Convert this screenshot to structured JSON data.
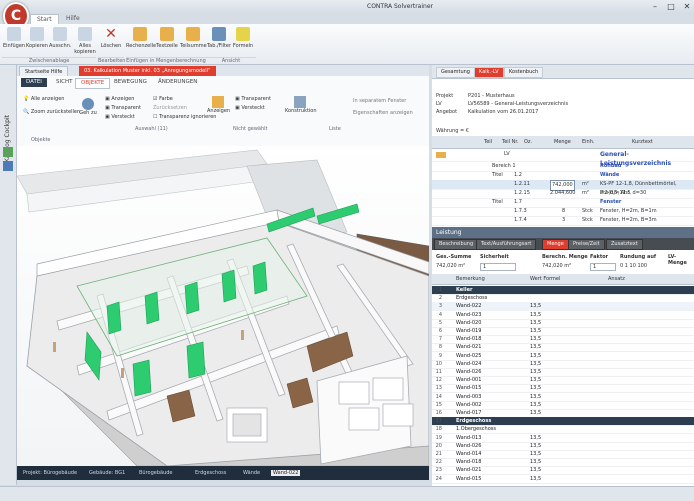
{
  "window": {
    "title": "CONTRA Solvertrainer",
    "min": "–",
    "max": "□",
    "close": "✕"
  },
  "ribbon_tabs": [
    {
      "label": "Start"
    },
    {
      "label": "Hilfe"
    }
  ],
  "ribbon_buttons": [
    {
      "label": "Einfügen"
    },
    {
      "label": "Kopieren"
    },
    {
      "label": "Ausschn."
    },
    {
      "label": "Alles kopieren"
    },
    {
      "label": "Löschen"
    },
    {
      "label": "Rechenzelle"
    },
    {
      "label": "Textzeile"
    },
    {
      "label": "Teilsumme"
    },
    {
      "label": "Tab./Filter"
    },
    {
      "label": "Formeln"
    }
  ],
  "ribbon_groups": [
    "Zwischenablage",
    "Bearbeiten",
    "Einfügen in Mengenberechnung",
    "Ansicht"
  ],
  "left_strip": {
    "label": "Katalog Cockpit"
  },
  "doc_tabs": [
    {
      "label": "Startseite Hilfe"
    },
    {
      "label": "03. Kalkulation Muster inkl. 03 „Anregungsmodell“"
    }
  ],
  "viewer_tabs": [
    {
      "label": "DATEI"
    },
    {
      "label": "SICHT"
    },
    {
      "label": "OBJEKTE"
    },
    {
      "label": "BEWEGUNG"
    },
    {
      "label": "ÄNDERUNGEN"
    }
  ],
  "viewer_ribbon": {
    "show_all": "Alle anzeigen",
    "zoom_back": "Zoom zurückstellen",
    "goto": "Geh zu",
    "display": "Anzeigen",
    "transparent": "Transparent",
    "hidden": "Versteckt",
    "color": "Farbe",
    "set_color": "Zurücksetzen",
    "transparent_ignore": "Transparenz ignorieren",
    "display2": "Anzeigen",
    "transparent2": "Transparent",
    "hidden2": "Versteckt",
    "construction": "Konstruktion",
    "separate_window": "In separatem Fenster",
    "properties_show": "Eigenschaften anzeigen",
    "group_objects": "Objekte",
    "group_selection": "Auswahl (11)",
    "group_not_selected": "Nicht gewählt",
    "group_list": "Liste"
  },
  "breadcrumbs": [
    "Projekt: Bürogebäude",
    "Gebäude: BG1",
    "Bürogebäude",
    "Erdgeschoss",
    "Wände",
    "Wand-022"
  ],
  "right_tabs": [
    {
      "label": "Gesamtung"
    },
    {
      "label": "Kalk.-LV"
    },
    {
      "label": "Kostenbuch"
    }
  ],
  "project_info": {
    "projekt_label": "Projekt",
    "projekt_value": "P201 - Musterhaus",
    "lv_label": "LV",
    "lv_value": "LV56589 - General-Leistungsverzeichnis",
    "angebot_label": "Angebot",
    "angebot_value": "Kalkulation vom 26.01.2017"
  },
  "currency": "Währung = €",
  "lv_grid_headers": [
    "Teil",
    "Teil Nr.",
    "Oz.",
    "Menge",
    "Einh.",
    "Kurztext"
  ],
  "lv_rows": [
    {
      "teil": "",
      "oz": "LV",
      "menge": "",
      "einh": "",
      "text": "General-Leistungsverzeichnis"
    },
    {
      "teil": "Bereich 1",
      "oz": "",
      "menge": "",
      "einh": "",
      "text": "Rohbau"
    },
    {
      "teil": "Titel",
      "oz": "1.2",
      "menge": "",
      "einh": "",
      "text": "Wände"
    },
    {
      "teil": "",
      "oz": "1.2.11",
      "menge": "742,000",
      "einh": "m²",
      "text": "KS-PF 12-1,8, Dünnbettmörtel, 8to(d)=11.5"
    },
    {
      "teil": "",
      "oz": "1.2.15",
      "menge": "2.044,600",
      "einh": "m²",
      "text": "P 2-0,5, Ahr, d=30"
    },
    {
      "teil": "Titel",
      "oz": "1.7",
      "menge": "",
      "einh": "",
      "text": "Fenster"
    },
    {
      "teil": "",
      "oz": "1.7.3",
      "menge": "8",
      "einh": "Stck",
      "text": "Fenster, H=2m, B=1m"
    },
    {
      "teil": "",
      "oz": "1.7.4",
      "menge": "3",
      "einh": "Stck",
      "text": "Fenster, H=2m, B=3m"
    }
  ],
  "lower_panel_title": "Leistung",
  "lower_tabs": [
    {
      "label": "Beschreibung"
    },
    {
      "label": "Text/Ausführungsart"
    },
    {
      "label": "Menge"
    },
    {
      "label": "Preise/Zeit"
    },
    {
      "label": "Zusatztext"
    }
  ],
  "calc": {
    "ges_summe_label": "Ges.-Summe",
    "ges_summe_value": "742,020 m²",
    "sicherheit_label": "Sicherheit",
    "sicherheit_value": "1",
    "berech_menge_label": "Berechn. Menge",
    "berech_menge_value": "742,020 m²",
    "faktor_label": "Faktor",
    "faktor_value": "1",
    "rundung_label": "Rundung auf",
    "rundung_options": "0 1 10 100",
    "lv_menge_label": "LV-Menge"
  },
  "qty_headers": [
    "Bemerkung",
    "Wert Formel",
    "Ansatz"
  ],
  "qty_rows": [
    {
      "n": "1",
      "name": "Keller",
      "val": "",
      "sect": true
    },
    {
      "n": "2",
      "name": "Erdgeschoss",
      "val": ""
    },
    {
      "n": "3",
      "name": "Wand-022",
      "val": "13,5"
    },
    {
      "n": "4",
      "name": "Wand-023",
      "val": "13,5"
    },
    {
      "n": "5",
      "name": "Wand-020",
      "val": "13,5"
    },
    {
      "n": "6",
      "name": "Wand-019",
      "val": "13,5"
    },
    {
      "n": "7",
      "name": "Wand-018",
      "val": "13,5"
    },
    {
      "n": "8",
      "name": "Wand-021",
      "val": "13,5"
    },
    {
      "n": "9",
      "name": "Wand-025",
      "val": "13,5"
    },
    {
      "n": "10",
      "name": "Wand-024",
      "val": "13,5"
    },
    {
      "n": "11",
      "name": "Wand-026",
      "val": "13,5"
    },
    {
      "n": "12",
      "name": "Wand-001",
      "val": "13,5"
    },
    {
      "n": "13",
      "name": "Wand-015",
      "val": "13,5"
    },
    {
      "n": "14",
      "name": "Wand-003",
      "val": "13,5"
    },
    {
      "n": "15",
      "name": "Wand-002",
      "val": "13,5"
    },
    {
      "n": "16",
      "name": "Wand-017",
      "val": "13,5"
    },
    {
      "n": "17",
      "name": "Erdgeschoss",
      "val": "",
      "sect": true
    },
    {
      "n": "18",
      "name": "1.Obergeschoss",
      "val": ""
    },
    {
      "n": "19",
      "name": "Wand-013",
      "val": "13,5"
    },
    {
      "n": "20",
      "name": "Wand-026",
      "val": "13,5"
    },
    {
      "n": "21",
      "name": "Wand-014",
      "val": "13,5"
    },
    {
      "n": "22",
      "name": "Wand-018",
      "val": "13,5"
    },
    {
      "n": "23",
      "name": "Wand-021",
      "val": "13,5"
    },
    {
      "n": "24",
      "name": "Wand-015",
      "val": "13,5"
    }
  ],
  "colors": {
    "accent_red": "#e03d2f",
    "navy": "#2c3e50",
    "wall_green": "#2ecc71"
  }
}
